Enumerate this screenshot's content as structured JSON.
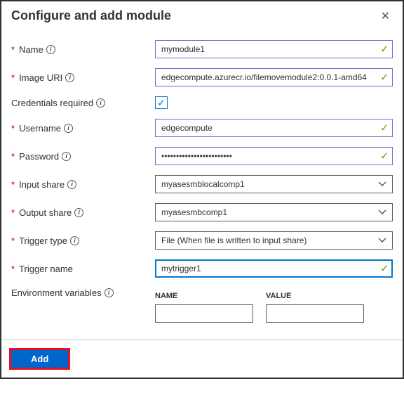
{
  "header": {
    "title": "Configure and add module"
  },
  "fields": {
    "name": {
      "label": "Name",
      "value": "mymodule1",
      "required": true,
      "info": true,
      "valid": true
    },
    "imageUri": {
      "label": "Image URI",
      "value": "edgecompute.azurecr.io/filemovemodule2:0.0.1-amd64",
      "required": true,
      "info": true,
      "valid": true
    },
    "credentialsRequired": {
      "label": "Credentials required",
      "checked": true,
      "info": true
    },
    "username": {
      "label": "Username",
      "value": "edgecompute",
      "required": true,
      "info": true,
      "valid": true
    },
    "password": {
      "label": "Password",
      "value": "••••••••••••••••••••••••",
      "required": true,
      "info": true,
      "valid": true
    },
    "inputShare": {
      "label": "Input share",
      "value": "myasesmblocalcomp1",
      "required": true,
      "info": true
    },
    "outputShare": {
      "label": "Output share",
      "value": "myasesmbcomp1",
      "required": true,
      "info": true
    },
    "triggerType": {
      "label": "Trigger type",
      "value": "File  (When file is written to input share)",
      "required": true,
      "info": true
    },
    "triggerName": {
      "label": "Trigger name",
      "value": "mytrigger1",
      "required": true,
      "valid": true,
      "focused": true
    },
    "envVars": {
      "label": "Environment variables",
      "info": true,
      "colName": "NAME",
      "colValue": "VALUE"
    }
  },
  "footer": {
    "addLabel": "Add"
  }
}
